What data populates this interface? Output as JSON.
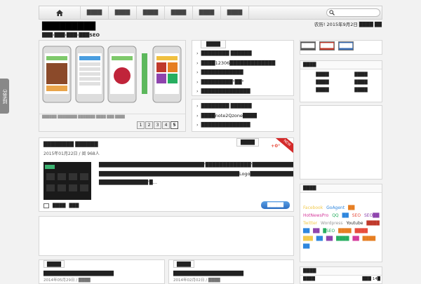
{
  "nav": {
    "home_icon": "home-icon",
    "items": [
      "████",
      "████",
      "████",
      "████",
      "████",
      "████"
    ]
  },
  "header": {
    "site_title": "█████████",
    "tagline": "███·███·███·███SEO",
    "date": "农历! 2015年9月2日 ████ ██"
  },
  "featured": {
    "tab_label": "████",
    "list_top": [
      "████████ ██████",
      "████12306█████████████",
      "████████████",
      "█████████\"██\"",
      "██████████████"
    ],
    "list_bottom": [
      "████████ ██████",
      "████note2Qzone████",
      "██████████████"
    ],
    "slider_pages": [
      "1",
      "2",
      "3",
      "4",
      "5"
    ],
    "slider_caption": "██████ ████████ ███████ ████ ███ ████"
  },
  "article": {
    "tab_label": "████",
    "title": "████████ ██████",
    "meta": "2015年01月22日 / 阅 968人",
    "score": "+0°",
    "ribbon": "NEW",
    "excerpt": "██████████████████████████████'█████████████'█████████████ ████████████████████████████████████████Logo█████████████████████████████████████████████████████████ ██████████████'█...",
    "footer_links": [
      "████",
      "███"
    ],
    "read_more": "█████"
  },
  "bottom_cards": [
    {
      "tab_label": "████",
      "title": "████████████████████",
      "meta": "2014年05月29日 / ████"
    },
    {
      "tab_label": "████",
      "title": "████████████████████",
      "meta": "2014年02月02日 / ████"
    }
  ],
  "sidebar": {
    "buttons": [
      "████",
      "████",
      "████"
    ],
    "button_colors": [
      "#555555",
      "#c0392b",
      "#3b6db3"
    ],
    "section1_title": "████",
    "section1_links": [
      "████",
      "████",
      "████",
      "████",
      "████",
      "████"
    ],
    "tags_title": "████",
    "tags": [
      {
        "text": "Facebook",
        "color": "#f2c94c"
      },
      {
        "text": "GoAgent",
        "color": "#2e86de"
      },
      {
        "text": "██",
        "color": "#e67e22"
      },
      {
        "text": "HotNewsPro",
        "color": "#d4399b"
      },
      {
        "text": "QQ",
        "color": "#27ae60"
      },
      {
        "text": "██",
        "color": "#2e86de"
      },
      {
        "text": "SEO",
        "color": "#e74c3c"
      },
      {
        "text": "SEO██",
        "color": "#8e44ad"
      },
      {
        "text": "Twitter",
        "color": "#f2c94c"
      },
      {
        "text": "Wordpress",
        "color": "#999999"
      },
      {
        "text": "Youtube",
        "color": "#333333"
      },
      {
        "text": "████",
        "color": "#c0392b"
      },
      {
        "text": "██",
        "color": "#2e86de"
      },
      {
        "text": "██",
        "color": "#8e44ad"
      },
      {
        "text": "█SEO",
        "color": "#27ae60"
      },
      {
        "text": "████",
        "color": "#e67e22"
      },
      {
        "text": "████",
        "color": "#e74c3c"
      },
      {
        "text": "███",
        "color": "#f2c94c"
      },
      {
        "text": "██",
        "color": "#2e86de"
      },
      {
        "text": "██",
        "color": "#8e44ad"
      },
      {
        "text": "████",
        "color": "#27ae60"
      },
      {
        "text": "██",
        "color": "#d4399b"
      },
      {
        "text": "████",
        "color": "#e67e22"
      },
      {
        "text": "██",
        "color": "#2e86de"
      }
    ],
    "section3_title": "████",
    "section3_links": [
      "████",
      "███ 14█"
    ]
  },
  "share": {
    "label": "分享到"
  }
}
